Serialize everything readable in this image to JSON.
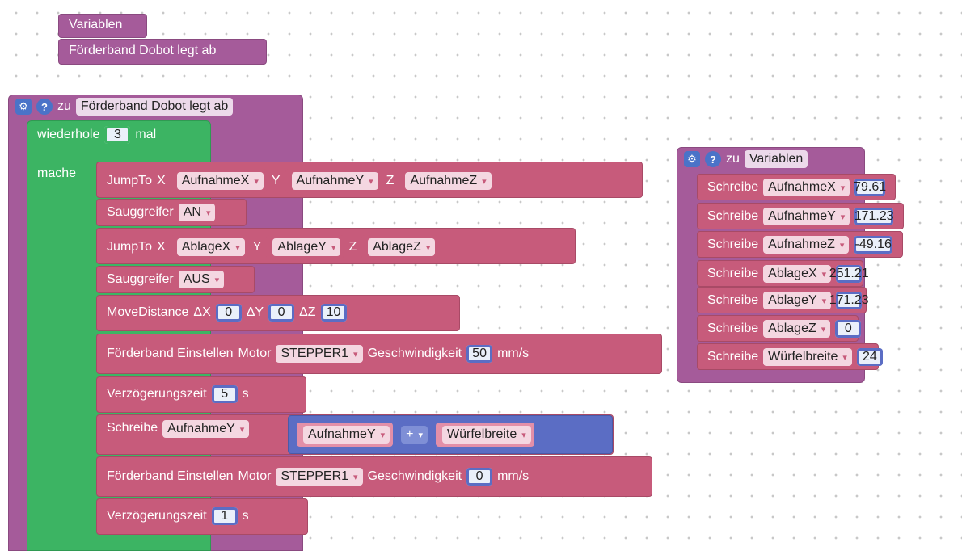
{
  "var_block": {
    "label": "Variablen"
  },
  "call_block": {
    "label": "Förderband Dobot legt ab"
  },
  "proc_main": {
    "zu": "zu",
    "name": "Förderband Dobot legt ab"
  },
  "repeat": {
    "label": "wiederhole",
    "count": "3",
    "mal": "mal",
    "mache": "mache"
  },
  "jump1": {
    "label": "JumpTo",
    "x": "X",
    "y": "Y",
    "z": "Z",
    "vx": "AufnahmeX",
    "vy": "AufnahmeY",
    "vz": "AufnahmeZ"
  },
  "grip1": {
    "label": "Sauggreifer",
    "value": "AN"
  },
  "jump2": {
    "label": "JumpTo",
    "x": "X",
    "y": "Y",
    "z": "Z",
    "vx": "AblageX",
    "vy": "AblageY",
    "vz": "AblageZ"
  },
  "grip2": {
    "label": "Sauggreifer",
    "value": "AUS"
  },
  "move": {
    "label": "MoveDistance",
    "dx": "ΔX",
    "dy": "ΔY",
    "dz": "ΔZ",
    "vx": "0",
    "vy": "0",
    "vz": "10"
  },
  "belt1": {
    "label": "Förderband Einstellen",
    "motor": "Motor",
    "motor_value": "STEPPER1",
    "speed": "Geschwindigkeit",
    "value": "50",
    "unit": "mm/s"
  },
  "delay1": {
    "label": "Verzögerungszeit",
    "value": "5",
    "unit": "s"
  },
  "write_main": {
    "label": "Schreibe",
    "var": "AufnahmeY",
    "a": "AufnahmeY",
    "op": "+",
    "b": "Würfelbreite"
  },
  "belt2": {
    "label": "Förderband Einstellen",
    "motor": "Motor",
    "motor_value": "STEPPER1",
    "speed": "Geschwindigkeit",
    "value": "0",
    "unit": "mm/s"
  },
  "delay2": {
    "label": "Verzögerungszeit",
    "value": "1",
    "unit": "s"
  },
  "proc_vars": {
    "zu": "zu",
    "name": "Variablen",
    "items": [
      {
        "label": "Schreibe",
        "var": "AufnahmeX",
        "value": "79.61"
      },
      {
        "label": "Schreibe",
        "var": "AufnahmeY",
        "value": "171.23"
      },
      {
        "label": "Schreibe",
        "var": "AufnahmeZ",
        "value": "-49.16"
      },
      {
        "label": "Schreibe",
        "var": "AblageX",
        "value": "251.21"
      },
      {
        "label": "Schreibe",
        "var": "AblageY",
        "value": "171.23"
      },
      {
        "label": "Schreibe",
        "var": "AblageZ",
        "value": "0"
      },
      {
        "label": "Schreibe",
        "var": "Würfelbreite",
        "value": "24"
      }
    ]
  },
  "icons": {
    "gear": "gear-icon",
    "help": "help-icon"
  }
}
